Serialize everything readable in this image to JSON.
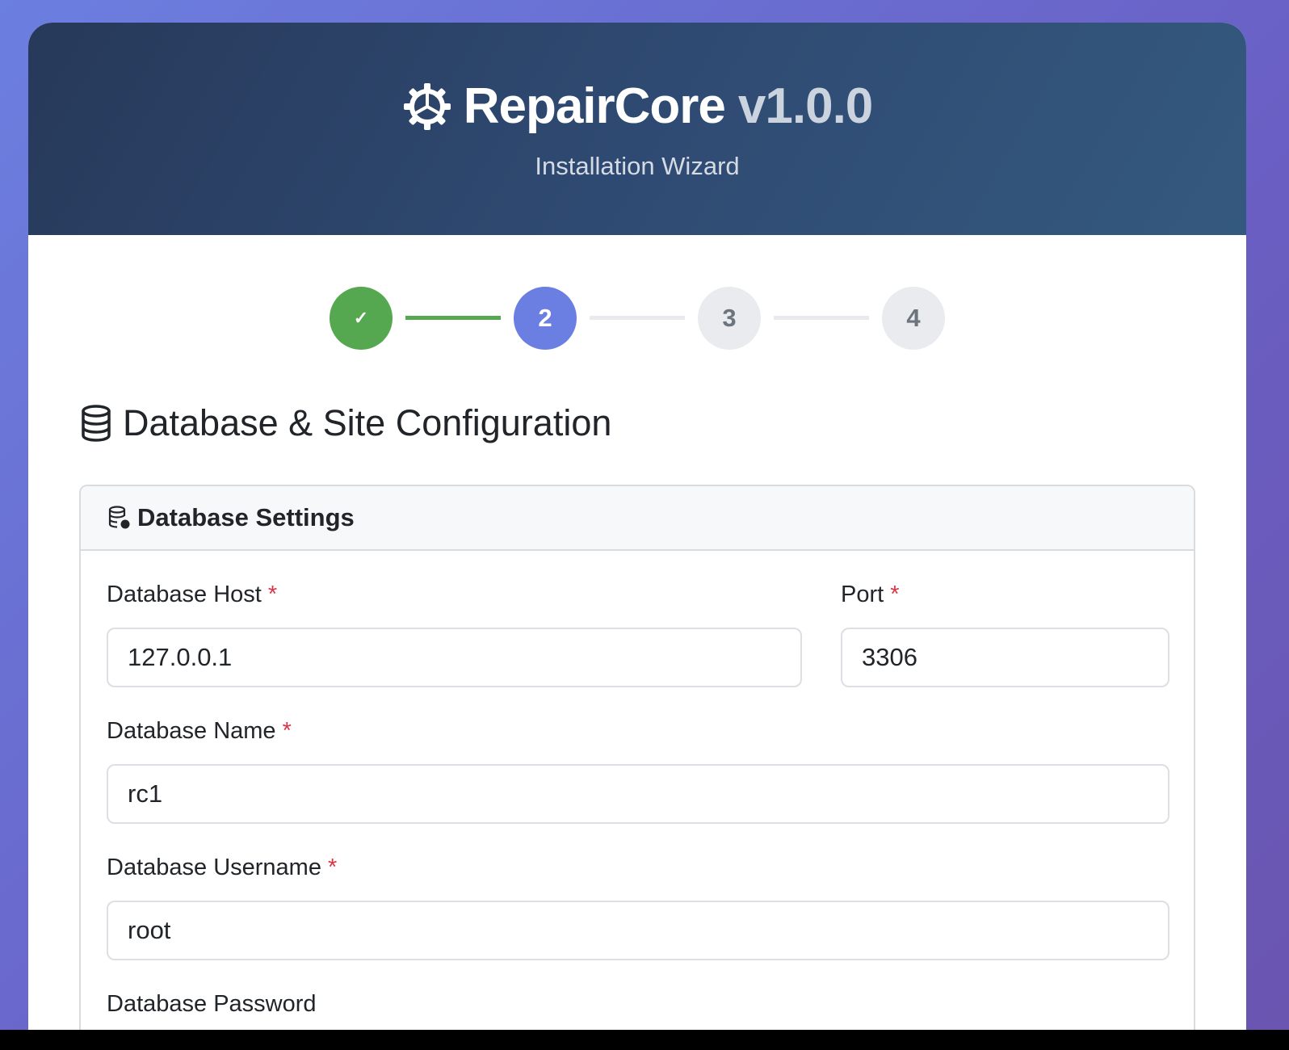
{
  "header": {
    "app_name": "RepairCore",
    "version": "v1.0.0",
    "subtitle": "Installation Wizard"
  },
  "stepper": {
    "steps": [
      {
        "label": "✓",
        "state": "complete"
      },
      {
        "label": "2",
        "state": "active"
      },
      {
        "label": "3",
        "state": "pending"
      },
      {
        "label": "4",
        "state": "pending"
      }
    ],
    "colors": {
      "complete": "#55a84f",
      "active": "#6b7fe3",
      "pending": "#e9ebee"
    }
  },
  "page_title": "Database & Site Configuration",
  "database_settings": {
    "title": "Database Settings",
    "required_mark": "*",
    "host": {
      "label": "Database Host",
      "value": "127.0.0.1"
    },
    "port": {
      "label": "Port",
      "value": "3306"
    },
    "name": {
      "label": "Database Name",
      "value": "rc1"
    },
    "username": {
      "label": "Database Username",
      "value": "root"
    },
    "password": {
      "label": "Database Password"
    }
  }
}
